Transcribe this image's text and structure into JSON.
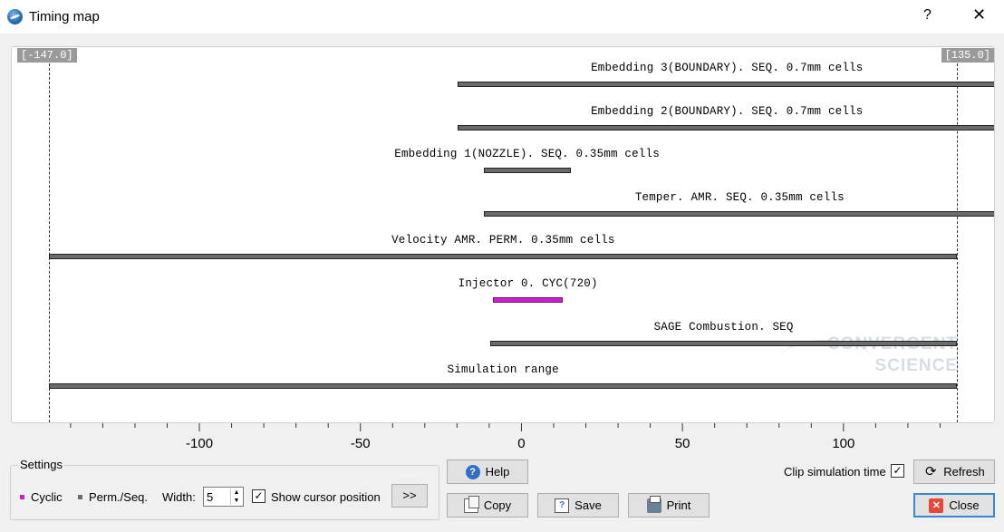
{
  "window": {
    "title": "Timing map",
    "help_glyph": "?",
    "close_glyph": "✕"
  },
  "plot": {
    "range_left": "[-147.0]",
    "range_right": "[135.0]",
    "watermark_line1": "CONVERGENT",
    "watermark_line2": "SCIENCE"
  },
  "chart_data": {
    "type": "bar",
    "orientation": "horizontal-range",
    "xlim": [
      -147,
      135
    ],
    "x_ticks": [
      -100,
      -50,
      0,
      50,
      100
    ],
    "x_tick_labels": [
      "-100",
      "-50",
      "0",
      "50",
      "100"
    ],
    "series": [
      {
        "label": "Embedding 3(BOUNDARY). SEQ. 0.7mm cells",
        "start": -20,
        "end": 147,
        "kind": "perm"
      },
      {
        "label": "Embedding 2(BOUNDARY). SEQ. 0.7mm cells",
        "start": -20,
        "end": 147,
        "kind": "perm"
      },
      {
        "label": "Embedding 1(NOZZLE). SEQ. 0.35mm cells",
        "start": -12,
        "end": 15,
        "kind": "perm"
      },
      {
        "label": "Temper. AMR. SEQ. 0.35mm cells",
        "start": -12,
        "end": 147,
        "kind": "perm"
      },
      {
        "label": "Velocity AMR. PERM. 0.35mm cells",
        "start": -147,
        "end": 135,
        "kind": "perm"
      },
      {
        "label": "Injector 0. CYC(720)",
        "start": -9,
        "end": 12.5,
        "kind": "cyclic"
      },
      {
        "label": "SAGE Combustion. SEQ",
        "start": -10,
        "end": 135,
        "kind": "perm"
      },
      {
        "label": "Simulation range",
        "start": -147,
        "end": 135,
        "kind": "perm"
      }
    ],
    "colors": {
      "perm": "#6b6b6b",
      "cyclic": "#cc22cc"
    }
  },
  "settings": {
    "title": "Settings",
    "legend_cyclic": "Cyclic",
    "legend_perm": "Perm./Seq.",
    "width_label": "Width:",
    "width_value": "5",
    "show_cursor_label": "Show cursor position",
    "show_cursor_checked": true,
    "more_label": ">>"
  },
  "buttons": {
    "help": "Help",
    "copy": "Copy",
    "save": "Save",
    "print": "Print",
    "refresh": "Refresh",
    "close": "Close"
  },
  "clip": {
    "label": "Clip simulation time",
    "checked": true
  },
  "icons": {
    "help": "help-icon",
    "copy": "copy-icon",
    "save": "save-icon",
    "print": "printer-icon",
    "refresh": "refresh-icon",
    "close": "close-icon"
  }
}
